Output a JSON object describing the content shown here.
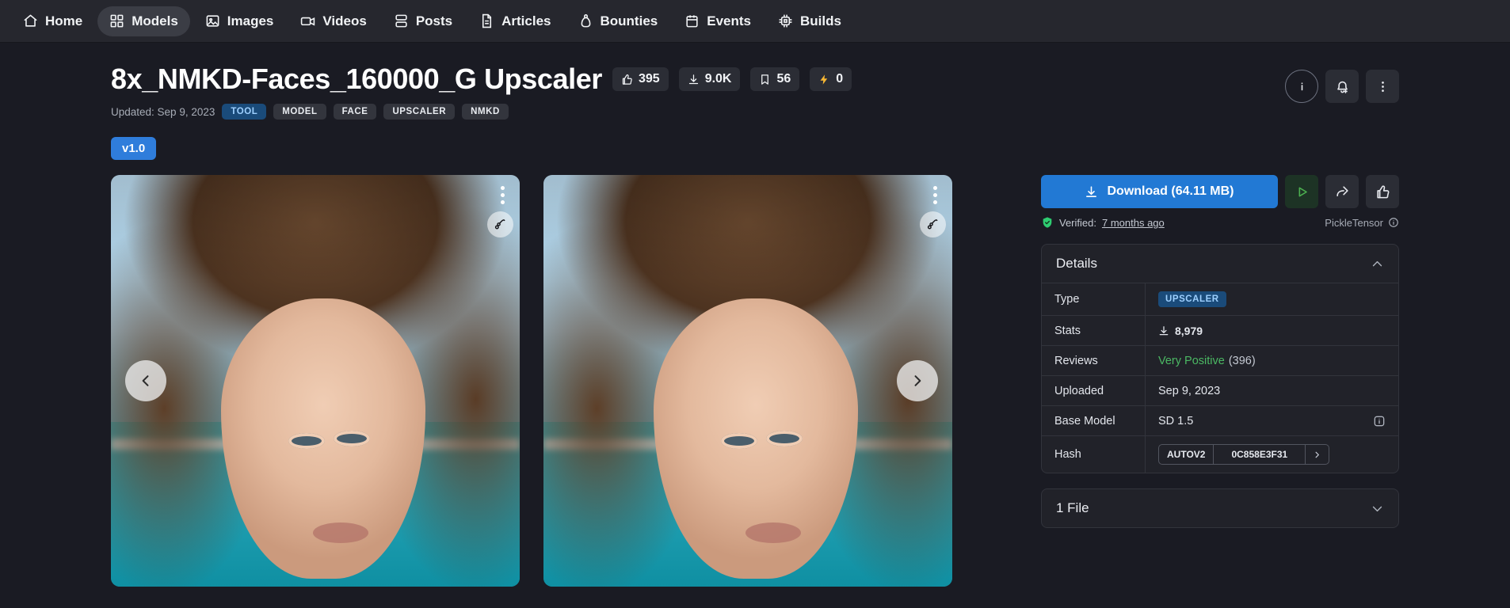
{
  "nav": {
    "items": [
      {
        "label": "Home",
        "icon": "home-icon",
        "active": false
      },
      {
        "label": "Models",
        "icon": "grid-icon",
        "active": true
      },
      {
        "label": "Images",
        "icon": "image-icon",
        "active": false
      },
      {
        "label": "Videos",
        "icon": "video-icon",
        "active": false
      },
      {
        "label": "Posts",
        "icon": "posts-icon",
        "active": false
      },
      {
        "label": "Articles",
        "icon": "article-icon",
        "active": false
      },
      {
        "label": "Bounties",
        "icon": "bounty-bag-icon",
        "active": false
      },
      {
        "label": "Events",
        "icon": "calendar-icon",
        "active": false
      },
      {
        "label": "Builds",
        "icon": "chip-icon",
        "active": false
      }
    ]
  },
  "header": {
    "title": "8x_NMKD-Faces_160000_G Upscaler",
    "stats": [
      {
        "icon": "thumbs-up-icon",
        "value": "395"
      },
      {
        "icon": "download-icon",
        "value": "9.0K"
      },
      {
        "icon": "bookmark-icon",
        "value": "56"
      },
      {
        "icon": "bolt-icon",
        "value": "0"
      }
    ],
    "updated": "Updated: Sep 9, 2023",
    "tags": [
      {
        "label": "TOOL",
        "primary": true
      },
      {
        "label": "MODEL",
        "primary": false
      },
      {
        "label": "FACE",
        "primary": false
      },
      {
        "label": "UPSCALER",
        "primary": false
      },
      {
        "label": "NMKD",
        "primary": false
      }
    ],
    "actions": [
      {
        "name": "info-button",
        "icon": "info-icon"
      },
      {
        "name": "notify-button",
        "icon": "bell-plus-icon"
      },
      {
        "name": "more-button",
        "icon": "dots-vertical-icon"
      }
    ],
    "version_badge": "v1.0"
  },
  "gallery": {
    "prev_label": "Previous image",
    "next_label": "Next image",
    "menu_label": "Image options",
    "remix_label": "Remix"
  },
  "side": {
    "download_label": "Download (64.11 MB)",
    "verified_prefix": "Verified:",
    "verified_time": "7 months ago",
    "pickle_label": "PickleTensor",
    "details": {
      "title": "Details",
      "rows": [
        {
          "key": "Type",
          "type": "chip",
          "value": "UPSCALER"
        },
        {
          "key": "Stats",
          "type": "downloads",
          "value": "8,979"
        },
        {
          "key": "Reviews",
          "type": "reviews",
          "value": "Very Positive",
          "count": "(396)"
        },
        {
          "key": "Uploaded",
          "type": "text",
          "value": "Sep 9, 2023"
        },
        {
          "key": "Base Model",
          "type": "text-info",
          "value": "SD 1.5"
        },
        {
          "key": "Hash",
          "type": "hash",
          "algorithm": "AUTOV2",
          "value": "0C858E3F31"
        }
      ]
    },
    "files": {
      "title": "1 File"
    }
  },
  "colors": {
    "background": "#1a1b23",
    "nav_background": "#26272e",
    "accent_blue": "#2279d4",
    "tag_blue": "#1a4b7a",
    "positive_green": "#4bb863",
    "play_green": "#4caf50",
    "panel": "#212229"
  }
}
